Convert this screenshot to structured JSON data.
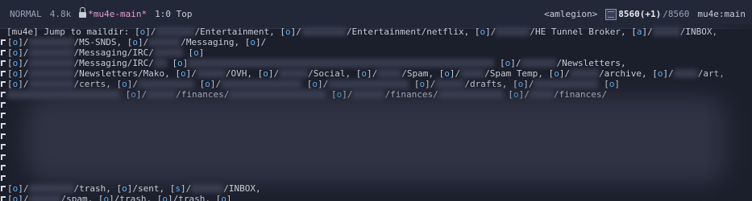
{
  "modeline": {
    "state": "NORMAL",
    "size": "4.8k",
    "buffer": "*mu4e-main*",
    "position": "1:0 Top",
    "account": "<amlegion>",
    "unread": "8560(+1)",
    "total": "/8560",
    "mode": "mu4e:main"
  },
  "prompt": "[mu4e] Jump to maildir: ",
  "key_o": "o",
  "key_a": "a",
  "key_s": "s",
  "lines": {
    "l1": [
      "/Entertainment,",
      "/Entertainment/netflix,",
      "/HE Tunnel Broker,",
      "/INBOX,"
    ],
    "l2": [
      "/MS-SNDS,",
      "/Messaging,"
    ],
    "l3": [
      "/Messaging/IRC/"
    ],
    "l4": [
      "/Messaging/IRC/",
      "/Newsletters,"
    ],
    "l5": [
      "/Newsletters/Mako,",
      "/OVH,",
      "/Social,",
      "/Spam,",
      "/Spam Temp,",
      "/archive,",
      "/art,"
    ],
    "l6": [
      "/certs,",
      "/drafts,"
    ],
    "l7": [
      "/finances/",
      "/finances/",
      "/finances/",
      "/finances/"
    ],
    "l15": [
      "/trash,",
      "/sent,",
      "/INBOX,"
    ],
    "l16": [
      "/spam,",
      "/trash,",
      "/trash,"
    ]
  }
}
